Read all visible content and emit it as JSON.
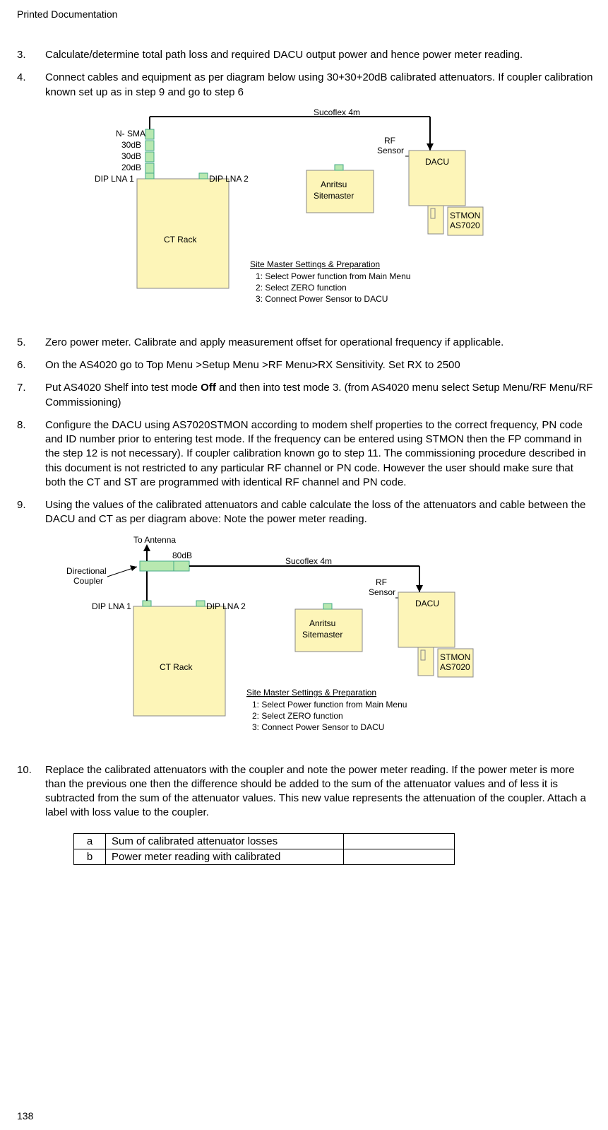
{
  "header": "Printed Documentation",
  "pageNumber": "138",
  "items": {
    "n3": "3.",
    "t3": "Calculate/determine total path loss and required DACU output power and hence power meter reading.",
    "n4": "4.",
    "t4": "Connect cables and equipment as per diagram below using 30+30+20dB calibrated attenuators. If coupler calibration known set up as in step 9 and go to step 6",
    "n5": "5.",
    "t5": "Zero power meter. Calibrate and apply measurement offset for operational frequency if applicable.",
    "n6": "6.",
    "t6": "On the AS4020 go to Top Menu >Setup Menu >RF Menu>RX Sensitivity. Set RX to 2500",
    "n7": "7.",
    "t7a": "Put AS4020 Shelf into test mode ",
    "t7b": "Off",
    "t7c": " and then into test mode 3. (from AS4020 menu select Setup Menu/RF Menu/RF Commissioning)",
    "n8": "8.",
    "t8": "Configure the DACU using AS7020STMON according to modem shelf properties to the correct frequency, PN code and ID number  prior to entering test mode. If the frequency can be entered using STMON then the FP command in the step 12 is not necessary). If coupler calibration  known go to step 11. The commissioning procedure described in this document is not restricted to any particular RF channel or PN code. However the user should make sure that both the CT and ST are programmed with identical RF channel and PN code.",
    "n9": "9.",
    "t9": "Using the values of the calibrated attenuators and cable calculate the loss of the attenuators and cable between the DACU and CT as per diagram above: Note the power meter reading.",
    "n10": "10.",
    "t10": "Replace the calibrated attenuators with the coupler and note the power meter reading. If the power meter is more than the previous one then the  difference should be added to the sum of the attenuator values and of less it is subtracted from the sum of the attenuator values. This new value represents the attenuation of the coupler. Attach a label with loss value to the coupler."
  },
  "diagram1": {
    "nsma": "N- SMA",
    "att30a": "30dB",
    "att30b": "30dB",
    "att20": "20dB",
    "dip1": "DIP LNA 1",
    "dip2": "DIP LNA 2",
    "ctrack": "CT Rack",
    "suco": "Sucoflex 4m",
    "rfsensor": "RF Sensor",
    "anritsu1": "Anritsu",
    "anritsu2": "Sitemaster",
    "dacu": "DACU",
    "stmon1": "STMON",
    "stmon2": "AS7020",
    "notesTitle": "Site Master  Settings  & Preparation",
    "note1": "1: Select Power function from Main Menu",
    "note2": "2: Select ZERO function",
    "note3": "3: Connect Power Sensor to DACU"
  },
  "diagram2": {
    "toant": "To Antenna",
    "dircoupler1": "Directional",
    "dircoupler2": "Coupler",
    "att80": "80dB",
    "dip1": "DIP LNA 1",
    "dip2": "DIP LNA 2",
    "ctrack": "CT Rack",
    "suco": "Sucoflex 4m",
    "rfsensor": "RF Sensor",
    "anritsu1": "Anritsu",
    "anritsu2": "Sitemaster",
    "dacu": "DACU",
    "stmon1": "STMON",
    "stmon2": "AS7020",
    "notesTitle": "Site Master  Settings  & Preparation",
    "note1": "1: Select Power function from Main Menu",
    "note2": "2: Select ZERO function",
    "note3": "3: Connect Power Sensor to DACU"
  },
  "table": {
    "r1a": "a",
    "r1b": "Sum of calibrated attenuator losses",
    "r1c": "",
    "r2a": "b",
    "r2b": "Power meter reading with calibrated",
    "r2c": ""
  }
}
